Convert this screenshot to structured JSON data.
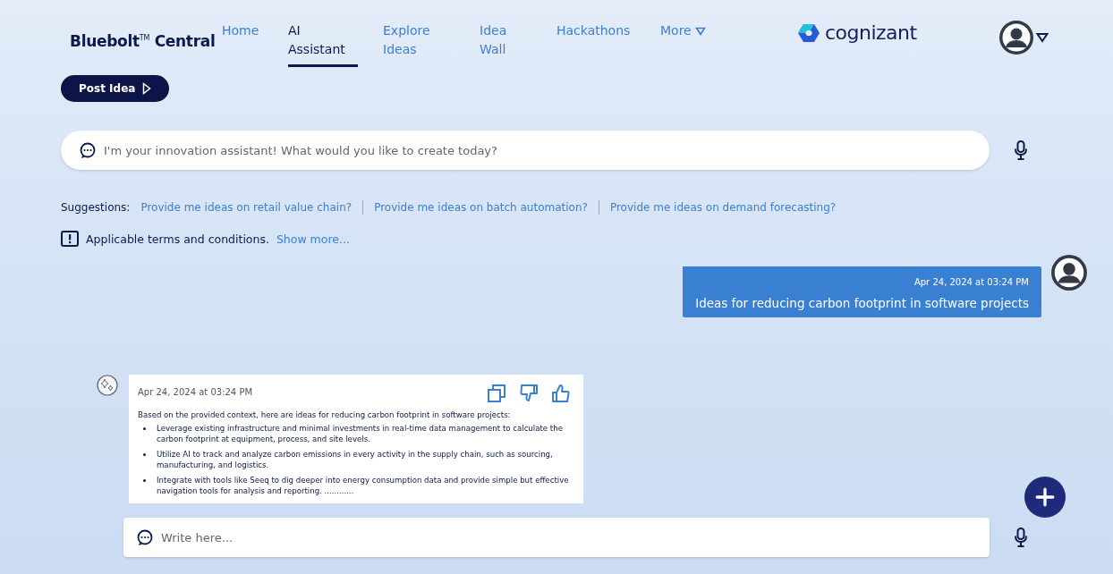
{
  "header": {
    "brand": "Bluebolt$^{TM}$ Central",
    "nav": [
      {
        "label": "Home",
        "selected": false
      },
      {
        "label": "AI Assistant",
        "selected": true
      },
      {
        "label": "Explore Ideas",
        "selected": false
      },
      {
        "label": "Idea Wall",
        "selected": false
      },
      {
        "label": "Hackathons",
        "selected": false
      },
      {
        "label": "More",
        "selected": false,
        "dropdown": true
      }
    ],
    "logo": "cognizant"
  },
  "post_button": "Post Idea",
  "search": {
    "placeholder": "I'm your innovation assistant! What would you like to create today?"
  },
  "suggestions": {
    "label": "Suggestions:",
    "items": [
      "Provide me ideas on retail value chain?",
      "Provide me ideas on batch automation?",
      "Provide me ideas on demand forecasting?"
    ]
  },
  "terms": {
    "text": "Applicable terms and conditions.",
    "link": "Show more..."
  },
  "messages": [
    {
      "kind": "user",
      "time": "Apr 24, 2024 at 03:24 PM",
      "text": "Ideas for reducing carbon footprint in software projects"
    },
    {
      "kind": "assistant",
      "time": "Apr 24, 2024 at 03:24 PM",
      "intro": "Based on the provided context, here are ideas for reducing carbon footprint in software projects:",
      "bullets": [
        "Leverage existing infrastructure and minimal investments in real-time data management to calculate the carbon footprint at equipment, process, and site levels.",
        "Utilize AI to track and analyze carbon emissions in every activity in the supply chain, such as sourcing, manufacturing, and logistics.",
        "Integrate with tools like Seeq to dig deeper into energy consumption data and provide simple but effective navigation tools for analysis and reporting. ............"
      ]
    }
  ],
  "composer": {
    "placeholder": "Write here..."
  }
}
